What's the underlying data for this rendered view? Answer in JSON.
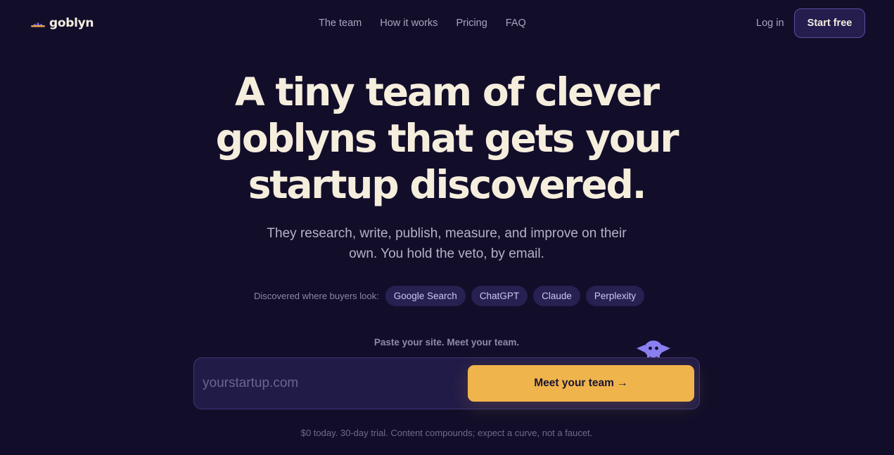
{
  "brand": {
    "name": "goblyn",
    "logo_icon": "goblin-logo-icon"
  },
  "nav": {
    "items": [
      {
        "label": "The team"
      },
      {
        "label": "How it works"
      },
      {
        "label": "Pricing"
      },
      {
        "label": "FAQ"
      }
    ],
    "login": "Log in",
    "start": "Start free"
  },
  "hero": {
    "title_lines": [
      "A tiny team of clever",
      "goblyns that gets your",
      "startup discovered."
    ],
    "subtitle_lines": [
      "They research, write, publish, measure, and improve on their",
      "own. You hold the veto, by email."
    ]
  },
  "discover": {
    "label": "Discovered where buyers look:",
    "chips": [
      {
        "label": "Google Search"
      },
      {
        "label": "ChatGPT"
      },
      {
        "label": "Claude"
      },
      {
        "label": "Perplexity"
      }
    ]
  },
  "signup": {
    "label": "Paste your site. Meet your team.",
    "placeholder": "yourstartup.com",
    "value": "",
    "cta": "Meet your team →",
    "mascot_icon": "goblin-mascot-icon",
    "fineprint": "$0 today. 30-day trial. Content compounds; expect a curve, not a faucet."
  },
  "colors": {
    "background": "#120e2a",
    "accent": "#f0b44c",
    "chip_bg": "#272151",
    "chip_text": "#cfc5f3",
    "mascot": "#8a7ff0"
  }
}
